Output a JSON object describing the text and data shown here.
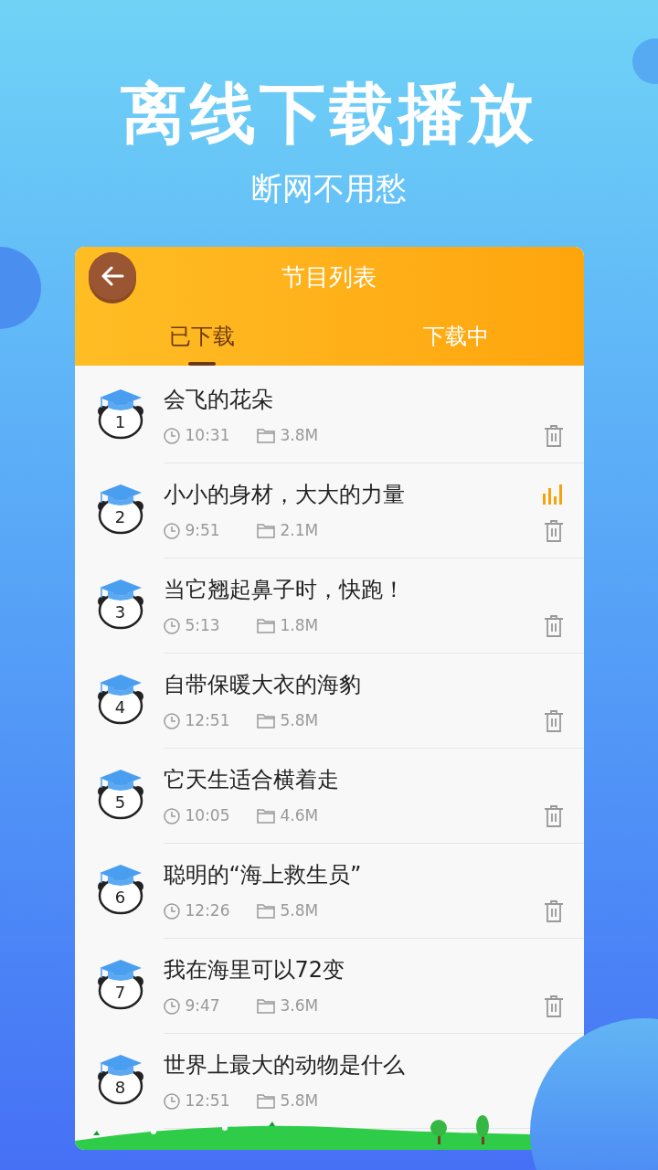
{
  "headline": "离线下载播放",
  "subheadline": "断网不用愁",
  "header": {
    "title": "节目列表"
  },
  "tabs": [
    {
      "label": "已下载",
      "selected": true
    },
    {
      "label": "下载中",
      "selected": false
    }
  ],
  "items": [
    {
      "number": "1",
      "title": "会飞的花朵",
      "duration": "10:31",
      "size": "3.8M",
      "playing": false,
      "delete_icon": true
    },
    {
      "number": "2",
      "title": "小小的身材，大大的力量",
      "duration": "9:51",
      "size": "2.1M",
      "playing": true,
      "delete_icon": true
    },
    {
      "number": "3",
      "title": "当它翘起鼻子时，快跑！",
      "duration": "5:13",
      "size": "1.8M",
      "playing": false,
      "delete_icon": true
    },
    {
      "number": "4",
      "title": "自带保暖大衣的海豹",
      "duration": "12:51",
      "size": "5.8M",
      "playing": false,
      "delete_icon": true
    },
    {
      "number": "5",
      "title": "它天生适合横着走",
      "duration": "10:05",
      "size": "4.6M",
      "playing": false,
      "delete_icon": true
    },
    {
      "number": "6",
      "title": "聪明的“海上救生员”",
      "duration": "12:26",
      "size": "5.8M",
      "playing": false,
      "delete_icon": true
    },
    {
      "number": "7",
      "title": "我在海里可以72变",
      "duration": "9:47",
      "size": "3.6M",
      "playing": false,
      "delete_icon": true
    },
    {
      "number": "8",
      "title": "世界上最大的动物是什么",
      "duration": "12:51",
      "size": "5.8M",
      "playing": false,
      "delete_icon": false
    }
  ]
}
